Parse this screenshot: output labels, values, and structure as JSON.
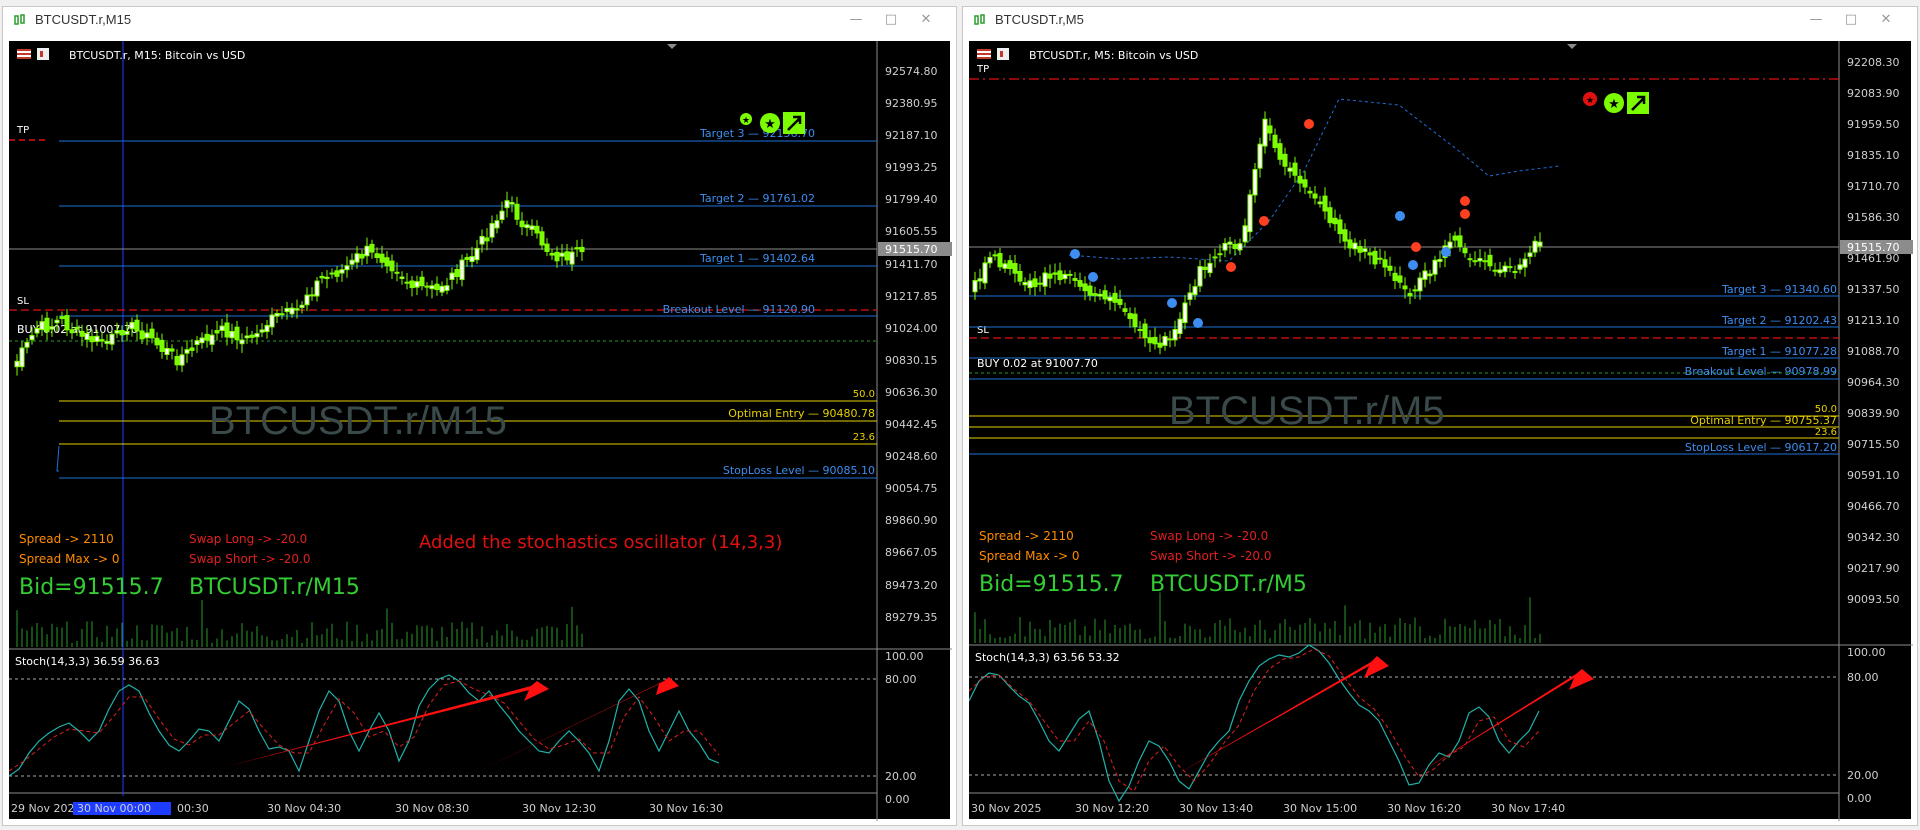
{
  "windows": [
    {
      "id": "w1",
      "title": "BTCUSDT.r,M15",
      "header": "BTCUSDT.r, M15:  Bitcoin vs USD",
      "watermark": "BTCUSDT.r/M15",
      "price_axis": [
        "92574.80",
        "92380.95",
        "92187.10",
        "91993.25",
        "91799.40",
        "91605.55",
        "91411.70",
        "91217.85",
        "91024.00",
        "90830.15",
        "90636.30",
        "90442.45",
        "90248.60",
        "90054.75",
        "89860.90",
        "89667.05",
        "89473.20",
        "89279.35"
      ],
      "current_price": "91515.70",
      "labels": {
        "tp": "TP",
        "sl": "SL",
        "buy": "BUY 0.02 at 91007.70",
        "target3": "Target 3 — 92156.70",
        "target2": "Target 2 — 91761.02",
        "target1": "Target 1 — 91402.64",
        "breakout": "Breakout Level — 91120.90",
        "fib50": "50.0",
        "optimal": "Optimal Entry — 90480.78",
        "fib236": "23.6",
        "stoploss": "StopLoss Level — 90085.10"
      },
      "info": {
        "spread": "Spread -> 2110",
        "spread_max": "Spread Max -> 0",
        "swap_long": "Swap Long -> -20.0",
        "swap_short": "Swap Short -> -20.0",
        "bid": "Bid=91515.7",
        "symbol": "BTCUSDT.r/M15"
      },
      "annotation": "Added the stochastics oscillator (14,3,3)",
      "stoch": {
        "label": "Stoch(14,3,3) 36.59 36.63",
        "levels": [
          "100.00",
          "80.00",
          "20.00",
          "0.00"
        ]
      },
      "time_axis": [
        "29 Nov 2025",
        "30 Nov 00:00",
        "00:30",
        "30 Nov 04:30",
        "30 Nov 08:30",
        "30 Nov 12:30",
        "30 Nov 16:30"
      ]
    },
    {
      "id": "w2",
      "title": "BTCUSDT.r,M5",
      "header": "BTCUSDT.r, M5:  Bitcoin vs USD",
      "watermark": "BTCUSDT.r/M5",
      "price_axis": [
        "92208.30",
        "92083.90",
        "91959.50",
        "91835.10",
        "91710.70",
        "91586.30",
        "91461.90",
        "91337.50",
        "91213.10",
        "91088.70",
        "90964.30",
        "90839.90",
        "90715.50",
        "90591.10",
        "90466.70",
        "90342.30",
        "90217.90",
        "90093.50"
      ],
      "current_price": "91515.70",
      "labels": {
        "tp": "TP",
        "sl": "SL",
        "buy": "BUY 0.02 at 91007.70",
        "target3": "Target 3 — 91340.60",
        "target2": "Target 2 — 91202.43",
        "target1": "Target 1 — 91077.28",
        "breakout": "Breakout Level — 90978.99",
        "fib50": "50.0",
        "optimal": "Optimal Entry — 90755.37",
        "fib236": "23.6",
        "stoploss": "StopLoss Level — 90617.20"
      },
      "info": {
        "spread": "Spread -> 2110",
        "spread_max": "Spread Max -> 0",
        "swap_long": "Swap Long -> -20.0",
        "swap_short": "Swap Short -> -20.0",
        "bid": "Bid=91515.7",
        "symbol": "BTCUSDT.r/M5"
      },
      "stoch": {
        "label": "Stoch(14,3,3) 63.56 53.32",
        "levels": [
          "100.00",
          "80.00",
          "20.00",
          "0.00"
        ]
      },
      "time_axis": [
        "30 Nov 2025",
        "30 Nov 12:20",
        "30 Nov 13:40",
        "30 Nov 15:00",
        "30 Nov 16:20",
        "30 Nov 17:40"
      ]
    }
  ],
  "colors": {
    "bg": "#000000",
    "candle": "#7CFC00",
    "target": "#1e6fd9",
    "target_text": "#3d8ef0",
    "fib": "#e6d000",
    "red": "#e01010",
    "grey": "#8c8c8c",
    "info_orange": "#ff8c00",
    "info_red": "#e02020",
    "info_green": "#33cc33",
    "stoch_main": "#20b2aa",
    "stoch_signal": "#e02020"
  },
  "icons": [
    "chart-window-icon",
    "minimize-icon",
    "maximize-icon",
    "close-icon",
    "star-icon",
    "up-arrow-icon"
  ]
}
